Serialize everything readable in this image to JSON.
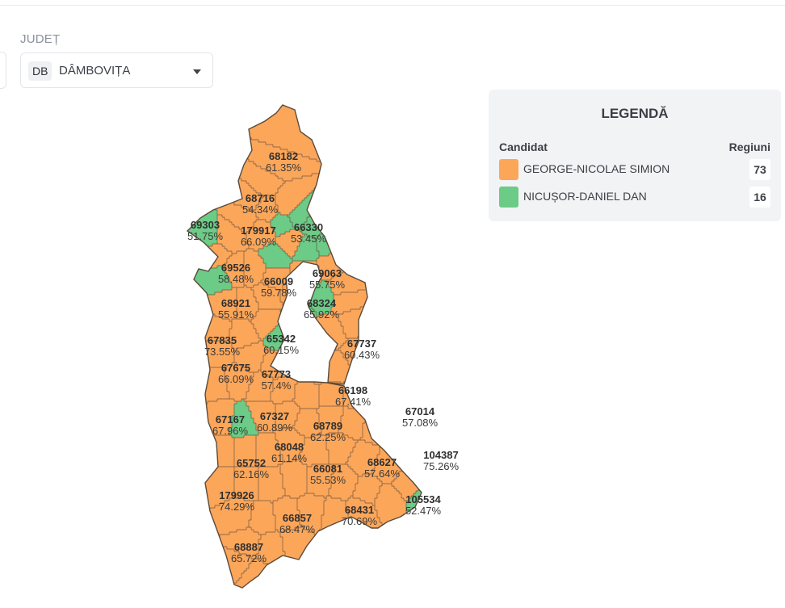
{
  "colors": {
    "simion": "#fca65a",
    "dan": "#6ccb86",
    "border": "#5a4a3a"
  },
  "filter": {
    "label": "JUDEȚ",
    "code": "DB",
    "name": "DÂMBOVIȚA"
  },
  "legend": {
    "title": "LEGENDĂ",
    "col_candidate": "Candidat",
    "col_regions": "Regiuni",
    "items": [
      {
        "name": "GEORGE-NICOLAE SIMION",
        "count": "73",
        "color": "#fca65a"
      },
      {
        "name": "NICUȘOR-DANIEL DAN",
        "count": "16",
        "color": "#6ccb86"
      }
    ]
  },
  "map_labels": [
    {
      "votes": "68182",
      "pct": "61.35%"
    },
    {
      "votes": "68716",
      "pct": "54.34%"
    },
    {
      "votes": "69303",
      "pct": "51.75%"
    },
    {
      "votes": "179917",
      "pct": "66.09%"
    },
    {
      "votes": "66330",
      "pct": "53.45%"
    },
    {
      "votes": "69526",
      "pct": "58.48%"
    },
    {
      "votes": "66009",
      "pct": "59.78%"
    },
    {
      "votes": "69063",
      "pct": "55.75%"
    },
    {
      "votes": "68921",
      "pct": "55.91%"
    },
    {
      "votes": "68324",
      "pct": "65.92%"
    },
    {
      "votes": "67835",
      "pct": "73.55%"
    },
    {
      "votes": "65342",
      "pct": "60.15%"
    },
    {
      "votes": "67737",
      "pct": "60.43%"
    },
    {
      "votes": "67675",
      "pct": "66.09%"
    },
    {
      "votes": "67773",
      "pct": "57.4%"
    },
    {
      "votes": "66198",
      "pct": "67.41%"
    },
    {
      "votes": "67014",
      "pct": "57.08%"
    },
    {
      "votes": "67167",
      "pct": "67.96%"
    },
    {
      "votes": "67327",
      "pct": "60.89%"
    },
    {
      "votes": "68789",
      "pct": "62.25%"
    },
    {
      "votes": "68048",
      "pct": "61.14%"
    },
    {
      "votes": "104387",
      "pct": "75.26%"
    },
    {
      "votes": "65752",
      "pct": "62.16%"
    },
    {
      "votes": "66081",
      "pct": "55.53%"
    },
    {
      "votes": "68627",
      "pct": "57.64%"
    },
    {
      "votes": "179926",
      "pct": "74.29%"
    },
    {
      "votes": "105534",
      "pct": "52.47%"
    },
    {
      "votes": "68431",
      "pct": "70.69%"
    },
    {
      "votes": "66857",
      "pct": "68.47%"
    },
    {
      "votes": "68887",
      "pct": "65.72%"
    }
  ]
}
